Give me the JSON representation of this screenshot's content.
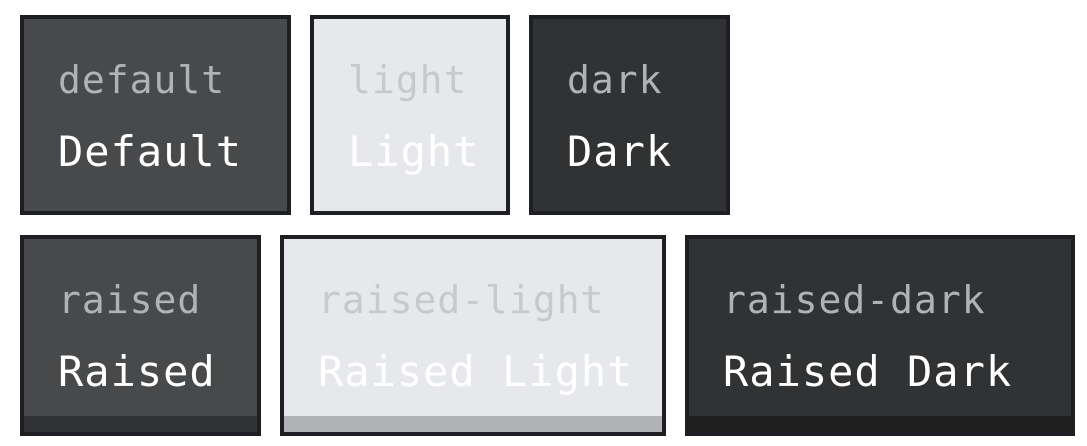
{
  "tiles": [
    {
      "variant": "default",
      "label": "Default",
      "bg": "#48494a"
    },
    {
      "variant": "light",
      "label": "Light",
      "bg": "#e6e8eb"
    },
    {
      "variant": "dark",
      "label": "Dark",
      "bg": "#313233"
    },
    {
      "variant": "raised",
      "label": "Raised",
      "bg": "#48494a",
      "shadow": "#313233"
    },
    {
      "variant": "raised-light",
      "label": "Raised Light",
      "bg": "#e6e8eb",
      "shadow": "#b1b2b5"
    },
    {
      "variant": "raised-dark",
      "label": "Raised Dark",
      "bg": "#313233",
      "shadow": "#1e1e1f"
    }
  ],
  "border_color": "#1e1f22"
}
